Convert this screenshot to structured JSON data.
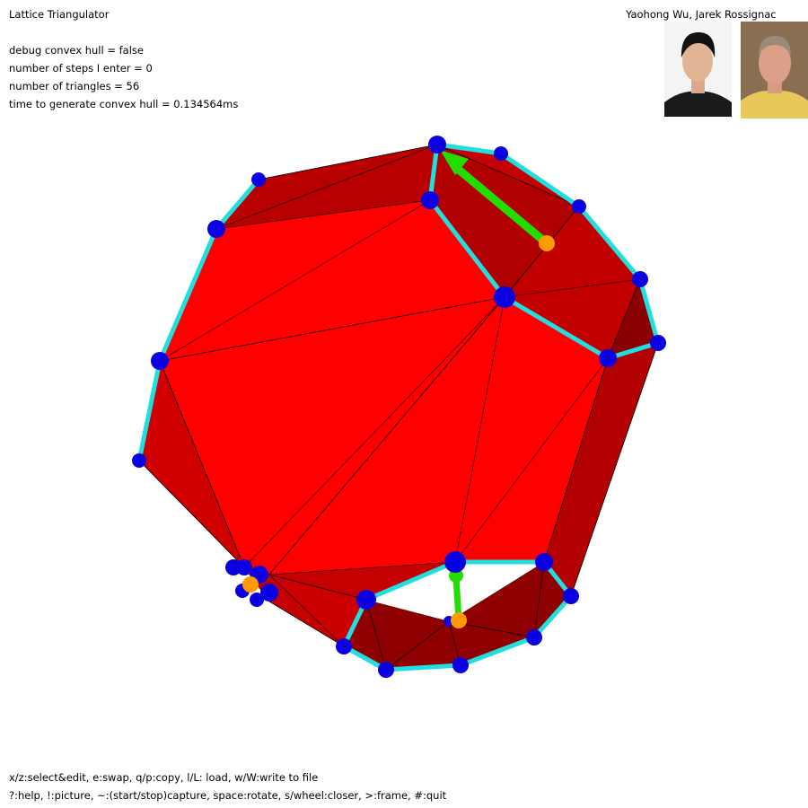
{
  "app": {
    "title": "Lattice Triangulator"
  },
  "authors": "Yaohong Wu, Jarek Rossignac",
  "status": {
    "debug_convex_hull": "debug convex hull = false",
    "steps": "number of steps I enter = 0",
    "triangles": "number of triangles = 56",
    "time": "time to generate convex hull = 0.134564ms"
  },
  "help": {
    "line1": "x/z:select&edit, e:swap, q/p:copy, l/L: load, w/W:write to file",
    "line2": "?:help, !:picture, ~:(start/stop)capture, space:rotate, s/wheel:closer, >:frame, #:quit"
  },
  "colors": {
    "face_bright": "#ff0000",
    "face_dark": "#c00000",
    "face_darker": "#8a0000",
    "edge_cyan": "#22dede",
    "vertex_blue": "#0a00e0",
    "arrow_green": "#22dd00",
    "marker_orange": "#ff9a00"
  }
}
